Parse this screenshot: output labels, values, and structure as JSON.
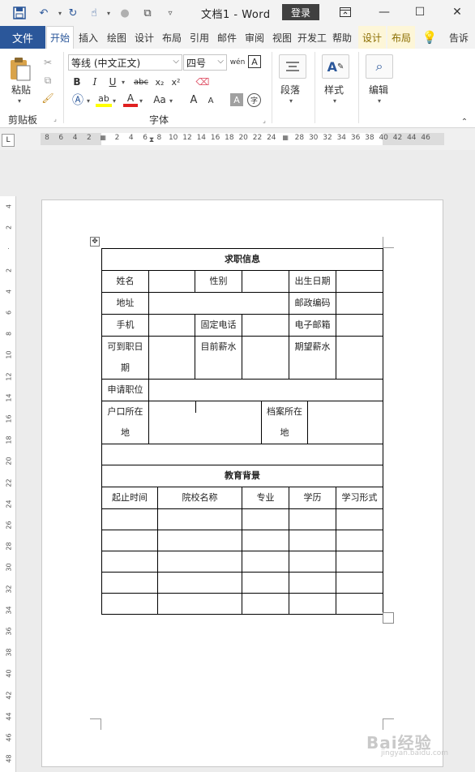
{
  "titlebar": {
    "doc_title": "文档1  -  Word",
    "login_label": "登录"
  },
  "tabs": {
    "file": "文件",
    "items": [
      "开始",
      "插入",
      "绘图",
      "设计",
      "布局",
      "引用",
      "邮件",
      "审阅",
      "视图",
      "开发工",
      "帮助"
    ],
    "context": [
      "设计",
      "布局"
    ],
    "tell_me": "告诉"
  },
  "clipboard": {
    "paste_label": "粘贴",
    "group_label": "剪贴板"
  },
  "font": {
    "font_name": "等线 (中文正文)",
    "font_size": "四号",
    "group_label": "字体",
    "bold": "B",
    "italic": "I",
    "underline": "U",
    "strike": "abc",
    "subscript": "x₂",
    "superscript": "x²",
    "case": "Aa",
    "grow": "A",
    "shrink": "A"
  },
  "paragraph": {
    "label": "段落"
  },
  "styles": {
    "label": "样式"
  },
  "editing": {
    "label": "编辑"
  },
  "ruler": {
    "corner": "L",
    "ticks": [
      "8",
      "6",
      "4",
      "2",
      "",
      "2",
      "4",
      "6",
      "8",
      "10",
      "12",
      "14",
      "16",
      "18",
      "20",
      "22",
      "24",
      "",
      "28",
      "30",
      "32",
      "34",
      "36",
      "38",
      "40",
      "42",
      "44",
      "46"
    ]
  },
  "vruler_ticks": [
    "4",
    "2",
    "",
    "2",
    "4",
    "6",
    "8",
    "10",
    "12",
    "14",
    "16",
    "18",
    "20",
    "22",
    "24",
    "26",
    "28",
    "30",
    "32",
    "34",
    "36",
    "38",
    "40",
    "42",
    "44",
    "46",
    "48"
  ],
  "table": {
    "title": "求职信息",
    "name": "姓名",
    "gender": "性别",
    "birth": "出生日期",
    "address": "地址",
    "zip": "邮政编码",
    "mobile": "手机",
    "phone": "固定电话",
    "email": "电子邮箱",
    "avail_a": "可到职日",
    "avail_b": "期",
    "cur_salary": "目前薪水",
    "exp_salary": "期望薪水",
    "position": "申请职位",
    "hukou_a": "户口所在",
    "hukou_b": "地",
    "dangan_a": "档案所在",
    "dangan_b": "地",
    "edu_title": "教育背景",
    "edu_headers": [
      "起止时间",
      "院校名称",
      "专业",
      "学历",
      "学习形式"
    ]
  },
  "watermark": {
    "brand": "Bai经验",
    "url": "jingyan.baidu.com"
  },
  "colors": {
    "accent": "#2b579a",
    "login_bg": "#404040"
  }
}
